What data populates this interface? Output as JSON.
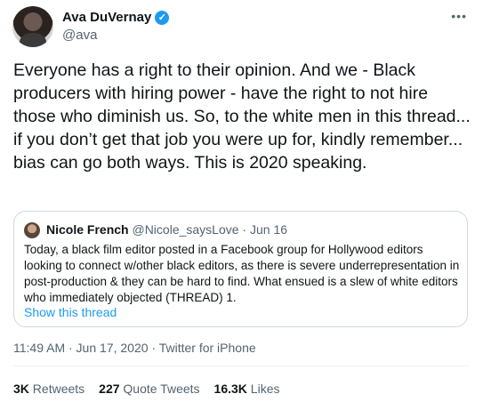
{
  "author": {
    "name": "Ava DuVernay",
    "handle": "@ava"
  },
  "tweet": {
    "text": "Everyone has a right to their opinion. And we - Black producers with hiring power - have the right to not hire those who diminish us. So, to the white men in this thread... if you don’t get that job you were up for, kindly remember... bias can go both ways. This is 2020 speaking."
  },
  "quote": {
    "name": "Nicole French",
    "handle": "@Nicole_saysLove",
    "separator": "·",
    "date": "Jun 16",
    "text": "Today, a black film editor posted in a Facebook group for Hollywood editors looking to connect w/other black editors, as there is severe underrepresentation in post-production & they can be hard to find.  What ensued is a slew of white editors who immediately objected (THREAD) 1.",
    "show_thread": "Show this thread"
  },
  "meta": {
    "text": "11:49 AM · Jun 17, 2020 · Twitter for iPhone"
  },
  "stats": {
    "retweets_count": "3K",
    "retweets_label": "Retweets",
    "quotes_count": "227",
    "quotes_label": "Quote Tweets",
    "likes_count": "16.3K",
    "likes_label": "Likes"
  },
  "icons": {
    "more": "more-horizontal-icon",
    "verified": "verified-badge-icon"
  }
}
